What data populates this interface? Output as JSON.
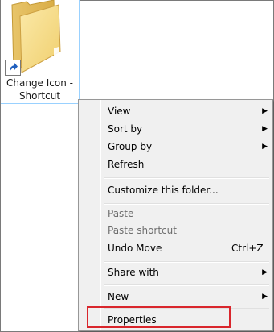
{
  "desktop_icon": {
    "label_line1": "Change Icon -",
    "label_line2": "Shortcut",
    "icon": "folder-icon",
    "badge": "shortcut-arrow-icon"
  },
  "context_menu": {
    "items": [
      {
        "label": "View",
        "submenu": true
      },
      {
        "label": "Sort by",
        "submenu": true
      },
      {
        "label": "Group by",
        "submenu": true
      },
      {
        "label": "Refresh"
      },
      {
        "label": "Customize this folder..."
      },
      {
        "label": "Paste",
        "disabled": true
      },
      {
        "label": "Paste shortcut",
        "disabled": true
      },
      {
        "label": "Undo Move",
        "shortcut": "Ctrl+Z"
      },
      {
        "label": "Share with",
        "submenu": true
      },
      {
        "label": "New",
        "submenu": true
      },
      {
        "label": "Properties"
      }
    ],
    "submenu_arrow": "▶"
  },
  "annotation": {
    "highlight_color": "#d9262c"
  }
}
